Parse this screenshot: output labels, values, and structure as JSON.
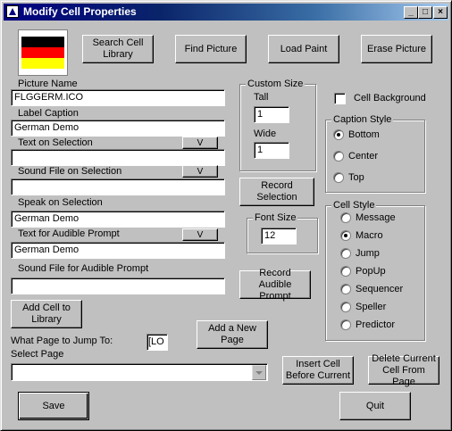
{
  "window": {
    "title": "Modify Cell Properties",
    "min_label": "_",
    "max_label": "□",
    "close_label": "×"
  },
  "top_buttons": {
    "search": "Search Cell Library",
    "find": "Find Picture",
    "load": "Load Paint",
    "erase": "Erase Picture"
  },
  "left": {
    "picture_name_label": "Picture Name",
    "picture_name_value": "FLGGERM.ICO",
    "label_caption_label": "Label Caption",
    "label_caption_value": "German Demo",
    "text_on_selection_label": "Text on Selection",
    "text_on_selection_value": "",
    "sound_on_selection_label": "Sound File on Selection",
    "sound_on_selection_value": "",
    "speak_on_selection_label": "Speak on Selection",
    "speak_on_selection_value": "German Demo",
    "audible_prompt_label": "Text for Audible Prompt",
    "audible_prompt_value": "German Demo",
    "sound_audible_label": "Sound File for Audible Prompt",
    "sound_audible_value": "",
    "v_button": "V",
    "add_cell": "Add Cell to Library",
    "jump_label": "What Page to Jump To:",
    "jump_value": "[LO",
    "select_page_label": "Select Page",
    "select_page_value": ""
  },
  "custom_size": {
    "title": "Custom Size",
    "tall_label": "Tall",
    "tall_value": "1",
    "wide_label": "Wide",
    "wide_value": "1"
  },
  "record_selection": "Record Selection",
  "font_size": {
    "title": "Font Size",
    "value": "12"
  },
  "record_audible": "Record Audible Prompt",
  "add_page": "Add a New Page",
  "cell_background": "Cell Background",
  "caption_style": {
    "title": "Caption Style",
    "options": [
      "Bottom",
      "Center",
      "Top"
    ],
    "selected": "Bottom"
  },
  "cell_style": {
    "title": "Cell Style",
    "options": [
      "Message",
      "Macro",
      "Jump",
      "PopUp",
      "Sequencer",
      "Speller",
      "Predictor"
    ],
    "selected": "Macro"
  },
  "insert_cell": "Insert Cell Before Current",
  "delete_cell": "Delete Current Cell From Page",
  "save": "Save",
  "quit": "Quit",
  "flag_colors": [
    "#000000",
    "#ff0000",
    "#ffff00"
  ]
}
